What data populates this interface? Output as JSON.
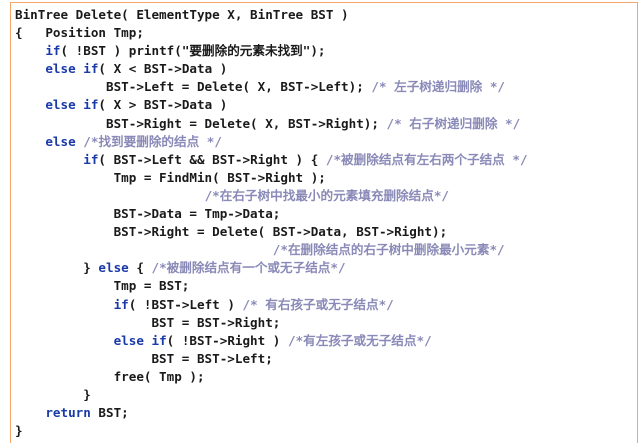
{
  "code_lines": [
    [
      {
        "t": "tx",
        "s": "BinTree Delete( ElementType X, BinTree BST )"
      }
    ],
    [
      {
        "t": "tx",
        "s": "{   Position Tmp;"
      }
    ],
    [
      {
        "t": "tx",
        "s": "    "
      },
      {
        "t": "kw",
        "s": "if"
      },
      {
        "t": "tx",
        "s": "( !BST ) printf(\"要删除的元素未找到\");"
      }
    ],
    [
      {
        "t": "tx",
        "s": "    "
      },
      {
        "t": "kw",
        "s": "else if"
      },
      {
        "t": "tx",
        "s": "( X < BST->Data )"
      }
    ],
    [
      {
        "t": "tx",
        "s": "            BST->Left = Delete( X, BST->Left); "
      },
      {
        "t": "cm",
        "s": "/* 左子树递归删除 */"
      }
    ],
    [
      {
        "t": "tx",
        "s": "    "
      },
      {
        "t": "kw",
        "s": "else if"
      },
      {
        "t": "tx",
        "s": "( X > BST->Data )"
      }
    ],
    [
      {
        "t": "tx",
        "s": "            BST->Right = Delete( X, BST->Right); "
      },
      {
        "t": "cm",
        "s": "/* 右子树递归删除 */"
      }
    ],
    [
      {
        "t": "tx",
        "s": "    "
      },
      {
        "t": "kw",
        "s": "else"
      },
      {
        "t": "tx",
        "s": " "
      },
      {
        "t": "cm",
        "s": "/*找到要删除的结点 */"
      }
    ],
    [
      {
        "t": "tx",
        "s": "         "
      },
      {
        "t": "kw",
        "s": "if"
      },
      {
        "t": "tx",
        "s": "( BST->Left && BST->Right ) { "
      },
      {
        "t": "cm",
        "s": "/*被删除结点有左右两个子结点 */"
      }
    ],
    [
      {
        "t": "tx",
        "s": "             Tmp = FindMin( BST->Right );"
      }
    ],
    [
      {
        "t": "tx",
        "s": "                         "
      },
      {
        "t": "cm",
        "s": "/*在右子树中找最小的元素填充删除结点*/"
      }
    ],
    [
      {
        "t": "tx",
        "s": "             BST->Data = Tmp->Data;"
      }
    ],
    [
      {
        "t": "tx",
        "s": "             BST->Right = Delete( BST->Data, BST->Right);"
      }
    ],
    [
      {
        "t": "tx",
        "s": "                                  "
      },
      {
        "t": "cm",
        "s": "/*在删除结点的右子树中删除最小元素*/"
      }
    ],
    [
      {
        "t": "tx",
        "s": "         } "
      },
      {
        "t": "kw",
        "s": "else"
      },
      {
        "t": "tx",
        "s": " { "
      },
      {
        "t": "cm",
        "s": "/*被删除结点有一个或无子结点*/"
      }
    ],
    [
      {
        "t": "tx",
        "s": "             Tmp = BST;"
      }
    ],
    [
      {
        "t": "tx",
        "s": "             "
      },
      {
        "t": "kw",
        "s": "if"
      },
      {
        "t": "tx",
        "s": "( !BST->Left ) "
      },
      {
        "t": "cm",
        "s": "/* 有右孩子或无子结点*/"
      }
    ],
    [
      {
        "t": "tx",
        "s": "                  BST = BST->Right;"
      }
    ],
    [
      {
        "t": "tx",
        "s": "             "
      },
      {
        "t": "kw",
        "s": "else if"
      },
      {
        "t": "tx",
        "s": "( !BST->Right ) "
      },
      {
        "t": "cm",
        "s": "/*有左孩子或无子结点*/"
      }
    ],
    [
      {
        "t": "tx",
        "s": "                  BST = BST->Left;"
      }
    ],
    [
      {
        "t": "tx",
        "s": "             free( Tmp );"
      }
    ],
    [
      {
        "t": "tx",
        "s": "         }"
      }
    ],
    [
      {
        "t": "tx",
        "s": "    "
      },
      {
        "t": "kw",
        "s": "return"
      },
      {
        "t": "tx",
        "s": " BST;"
      }
    ],
    [
      {
        "t": "tx",
        "s": "}"
      }
    ]
  ],
  "colors": {
    "text": "#1a1a1a",
    "keyword": "#1a3aa8",
    "comment": "#8a8ab8",
    "frame_border": "#f3a86a"
  }
}
